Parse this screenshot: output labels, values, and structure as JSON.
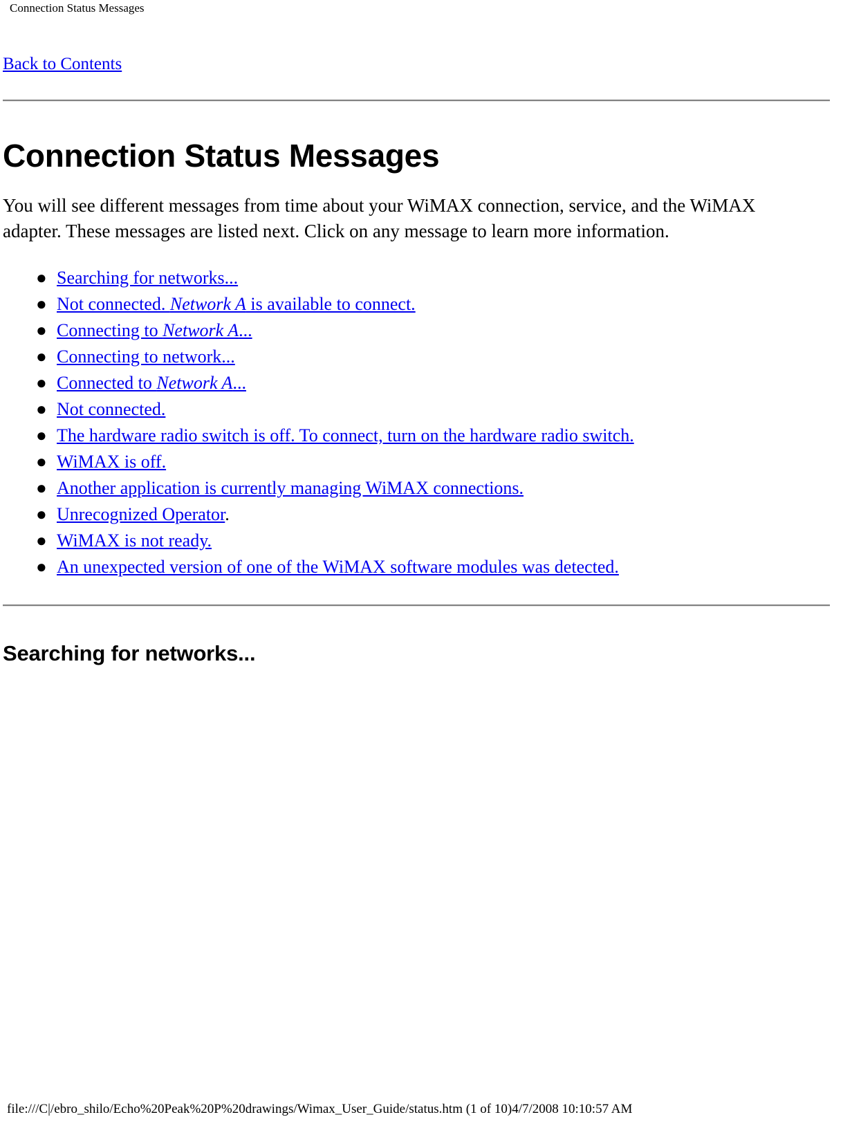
{
  "header": {
    "running_title": "Connection Status Messages"
  },
  "nav": {
    "back_link": "Back to Contents"
  },
  "main": {
    "title": "Connection Status Messages",
    "intro": "You will see different messages from time about your WiMAX connection, service, and the WiMAX adapter. These messages are listed next. Click on any message to learn more information.",
    "bullet_glyph": "●",
    "messages": [
      {
        "pre": "",
        "link_a": "Searching for networks...",
        "italic": "",
        "link_b": "",
        "post": ""
      },
      {
        "pre": "",
        "link_a": "Not connected. ",
        "italic": "Network A",
        "link_b": " is available to connect.",
        "post": ""
      },
      {
        "pre": "",
        "link_a": "Connecting to ",
        "italic": "Network A",
        "link_b": "...",
        "post": ""
      },
      {
        "pre": "",
        "link_a": "Connecting to network...",
        "italic": "",
        "link_b": "",
        "post": ""
      },
      {
        "pre": "",
        "link_a": "Connected to ",
        "italic": "Network A",
        "link_b": "...",
        "post": ""
      },
      {
        "pre": "",
        "link_a": "Not connected.",
        "italic": "",
        "link_b": "",
        "post": ""
      },
      {
        "pre": "",
        "link_a": "The hardware radio switch is off. To connect, turn on the hardware radio switch.",
        "italic": "",
        "link_b": "",
        "post": ""
      },
      {
        "pre": "",
        "link_a": "WiMAX is off.",
        "italic": "",
        "link_b": "",
        "post": ""
      },
      {
        "pre": "",
        "link_a": "Another application is currently managing WiMAX connections.",
        "italic": "",
        "link_b": "",
        "post": ""
      },
      {
        "pre": "",
        "link_a": "Unrecognized Operator",
        "italic": "",
        "link_b": "",
        "post": "."
      },
      {
        "pre": "",
        "link_a": "WiMAX is not ready. ",
        "italic": "",
        "link_b": "",
        "post": ""
      },
      {
        "pre": "",
        "link_a": "An unexpected version of one of the WiMAX software modules was detected.",
        "italic": "",
        "link_b": "",
        "post": ""
      }
    ],
    "section_title": "Searching for networks..."
  },
  "footer": {
    "path_line": "file:///C|/ebro_shilo/Echo%20Peak%20P%20drawings/Wimax_User_Guide/status.htm (1 of 10)4/7/2008 10:10:57 AM"
  },
  "colors": {
    "link": "#0000ee",
    "text": "#000000",
    "rule_dark": "#808080",
    "rule_light": "#e3e3e3",
    "background": "#ffffff"
  }
}
